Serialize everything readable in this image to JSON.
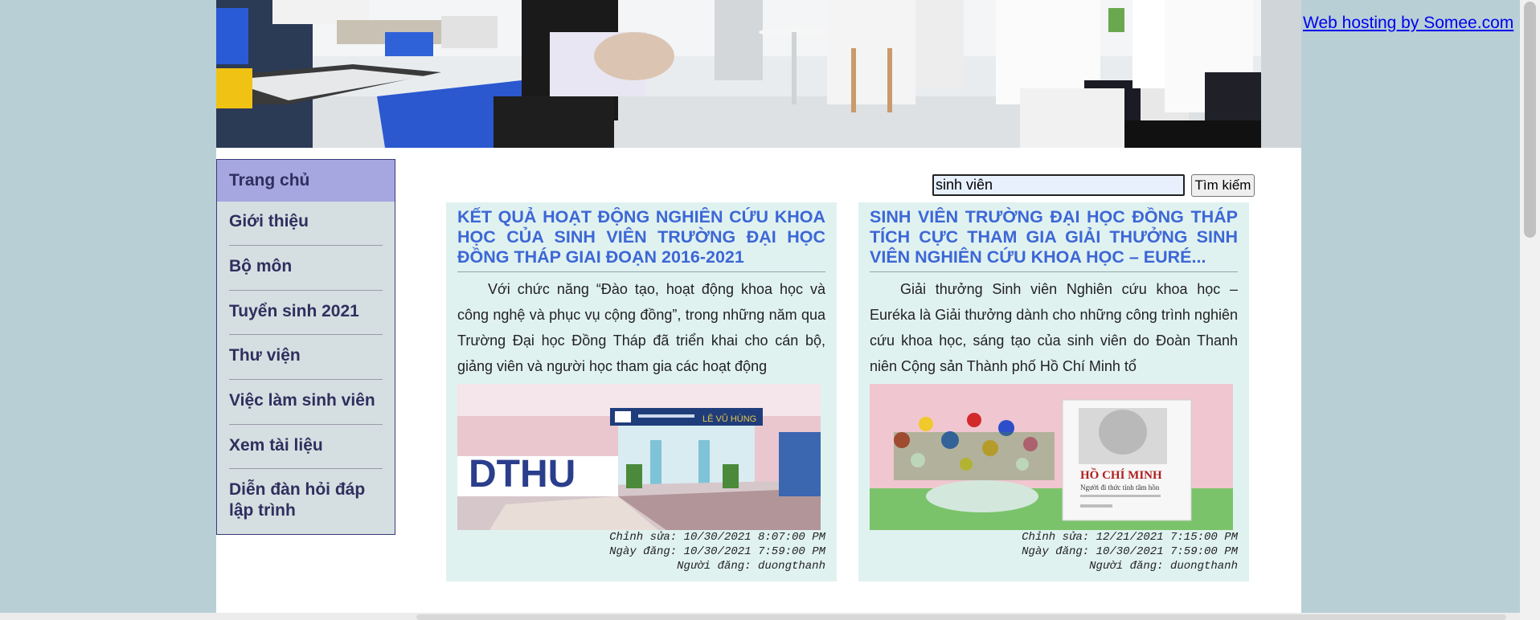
{
  "hosting_link": "Web hosting by Somee.com",
  "nav": {
    "items": [
      {
        "label": "Trang chủ",
        "active": true
      },
      {
        "label": "Giới thiệu"
      },
      {
        "label": "Bộ môn"
      },
      {
        "label": "Tuyển sinh 2021"
      },
      {
        "label": "Thư viện"
      },
      {
        "label": "Việc làm sinh viên"
      },
      {
        "label": "Xem tài liệu"
      },
      {
        "label": "Diễn đàn hỏi đáp lập trình"
      }
    ]
  },
  "search": {
    "value": "sinh viên",
    "button_label": "Tìm kiếm"
  },
  "posts": [
    {
      "title": "KẾT QUẢ HOẠT ĐỘNG NGHIÊN CỨU KHOA HỌC CỦA SINH VIÊN TRƯỜNG ĐẠI HỌC ĐỒNG THÁP GIAI ĐOẠN 2016-2021",
      "excerpt": "Với chức năng “Đào tạo, hoạt động khoa học và công nghệ và phục vụ cộng đồng”, trong những năm qua Trường Đại học Đồng Tháp đã triển khai cho cán bộ, giảng viên và người học tham gia các hoạt động",
      "image_caption": "DTHU",
      "edited": "Chỉnh sửa: 10/30/2021 8:07:00 PM",
      "posted": "Ngày đăng: 10/30/2021 7:59:00 PM",
      "author": "Người đăng: duongthanh"
    },
    {
      "title": "SINH VIÊN TRƯỜNG ĐẠI HỌC ĐỒNG THÁP TÍCH CỰC THAM GIA GIẢI THƯỞNG SINH VIÊN NGHIÊN CỨU KHOA HỌC – EURÉ...",
      "excerpt": "Giải thưởng Sinh viên Nghiên cứu khoa học – Euréka là Giải thưởng dành cho những công trình nghiên cứu khoa học, sáng tạo của sinh viên do Đoàn Thanh niên Cộng sản Thành phố Hồ Chí Minh tổ",
      "image_caption": "HỒ CHÍ MINH",
      "image_subcaption": "Người đi thức tỉnh tâm hồn",
      "edited": "Chỉnh sửa: 12/21/2021 7:15:00 PM",
      "posted": "Ngày đăng: 10/30/2021 7:59:00 PM",
      "author": "Người đăng: duongthanh"
    }
  ]
}
